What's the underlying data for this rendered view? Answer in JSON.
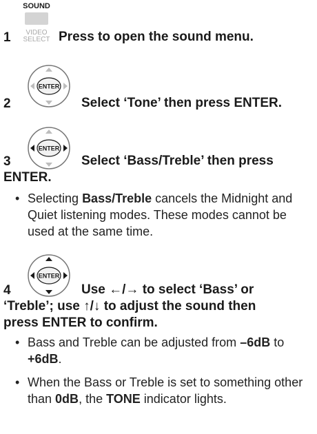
{
  "step1": {
    "number": "1",
    "button_label_top": "SOUND",
    "button_label_line1": "VIDEO",
    "button_label_line2": "SELECT",
    "text": "Press to open the sound menu."
  },
  "step2": {
    "number": "2",
    "enter_label": "ENTER",
    "text": "Select ‘Tone’ then press ENTER."
  },
  "step3": {
    "number": "3",
    "enter_label": "ENTER",
    "text_line1": "Select ‘Bass/Treble’ then press",
    "text_line2": "ENTER.",
    "bullet1": {
      "pre": "Selecting ",
      "bold": "Bass/Treble",
      "post": " cancels the Midnight and Quiet listening modes. These modes cannot be used at the same time."
    }
  },
  "step4": {
    "number": "4",
    "enter_label": "ENTER",
    "text_line1": "Use ←/→ to select ‘Bass’ or",
    "text_line2": "‘Treble’; use ↑/↓ to adjust the sound then",
    "text_line3": "press ENTER to confirm.",
    "bullet1": {
      "pre": "Bass and Treble can be adjusted from ",
      "bold1": "–6dB",
      "mid": " to ",
      "bold2": "+6dB",
      "post": "."
    },
    "bullet2": {
      "pre": "When the Bass or Treble is set to something other than ",
      "bold1": "0dB",
      "mid": ", the ",
      "bold2": "TONE",
      "post": " indicator lights."
    }
  }
}
